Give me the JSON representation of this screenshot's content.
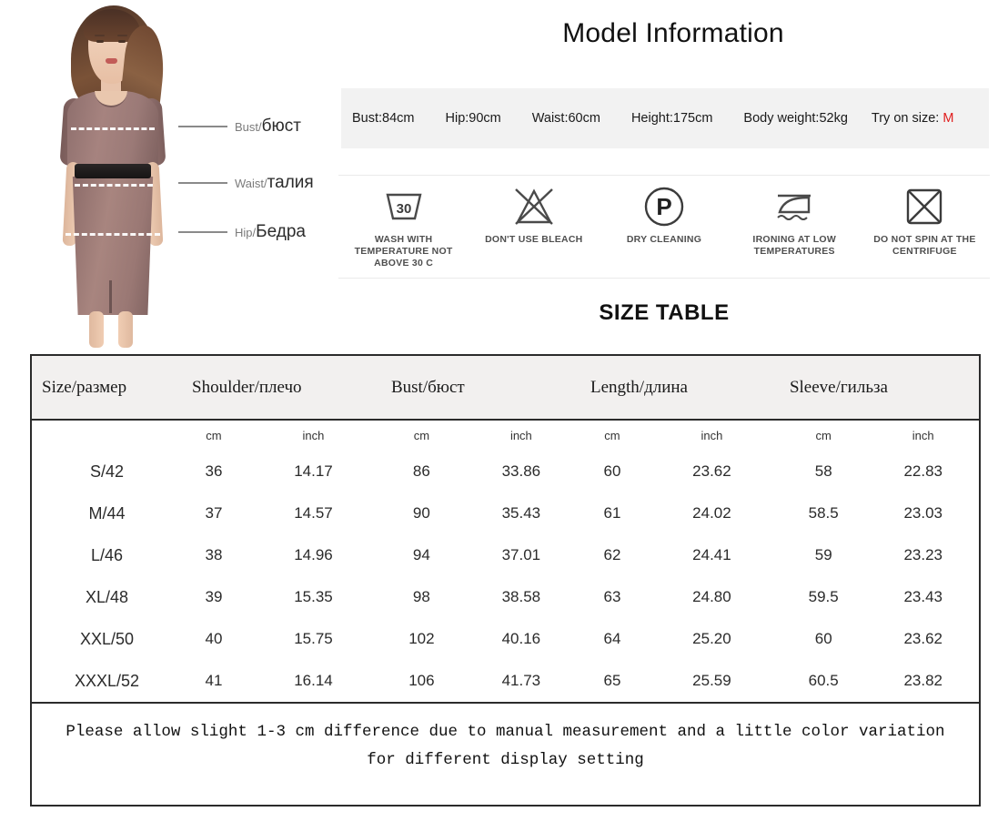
{
  "model_panel": {
    "callouts": [
      {
        "en": "Bust/",
        "ru": "бюст"
      },
      {
        "en": "Waist/",
        "ru": "талия"
      },
      {
        "en": "Hip/",
        "ru": "Бедра"
      }
    ]
  },
  "model_info": {
    "title": "Model Information",
    "measurements": [
      "Bust:84cm",
      "Hip:90cm",
      "Waist:60cm",
      "Height:175cm",
      "Body weight:52kg"
    ],
    "try_on_label": "Try on size:",
    "try_on_size": "M",
    "try_on_color": "#e01b1b"
  },
  "care": {
    "items": [
      {
        "icon": "wash-tub-30-icon",
        "label": "WASH WITH TEMPERATURE NOT ABOVE 30 C",
        "temp": "30"
      },
      {
        "icon": "no-bleach-triangle-icon",
        "label": "DON'T USE BLEACH"
      },
      {
        "icon": "dry-clean-p-circle-icon",
        "label": "DRY CLEANING",
        "letter": "P"
      },
      {
        "icon": "iron-low-temp-icon",
        "label": "IRONING AT LOW TEMPERATURES"
      },
      {
        "icon": "no-spin-centrifuge-icon",
        "label": "DO NOT SPIN AT THE CENTRIFUGE"
      }
    ]
  },
  "size_table": {
    "title": "SIZE TABLE",
    "headers": [
      "Size/размер",
      "Shoulder/плечо",
      "Bust/бюст",
      "Length/длина",
      "Sleeve/гильза"
    ],
    "units": [
      "",
      "cm",
      "inch",
      "cm",
      "inch",
      "cm",
      "inch",
      "cm",
      "inch"
    ],
    "rows": [
      {
        "size": "S/42",
        "shoulder_cm": "36",
        "shoulder_in": "14.17",
        "bust_cm": "86",
        "bust_in": "33.86",
        "length_cm": "60",
        "length_in": "23.62",
        "sleeve_cm": "58",
        "sleeve_in": "22.83"
      },
      {
        "size": "M/44",
        "shoulder_cm": "37",
        "shoulder_in": "14.57",
        "bust_cm": "90",
        "bust_in": "35.43",
        "length_cm": "61",
        "length_in": "24.02",
        "sleeve_cm": "58.5",
        "sleeve_in": "23.03"
      },
      {
        "size": "L/46",
        "shoulder_cm": "38",
        "shoulder_in": "14.96",
        "bust_cm": "94",
        "bust_in": "37.01",
        "length_cm": "62",
        "length_in": "24.41",
        "sleeve_cm": "59",
        "sleeve_in": "23.23"
      },
      {
        "size": "XL/48",
        "shoulder_cm": "39",
        "shoulder_in": "15.35",
        "bust_cm": "98",
        "bust_in": "38.58",
        "length_cm": "63",
        "length_in": "24.80",
        "sleeve_cm": "59.5",
        "sleeve_in": "23.43"
      },
      {
        "size": "XXL/50",
        "shoulder_cm": "40",
        "shoulder_in": "15.75",
        "bust_cm": "102",
        "bust_in": "40.16",
        "length_cm": "64",
        "length_in": "25.20",
        "sleeve_cm": "60",
        "sleeve_in": "23.62"
      },
      {
        "size": "XXXL/52",
        "shoulder_cm": "41",
        "shoulder_in": "16.14",
        "bust_cm": "106",
        "bust_in": "41.73",
        "length_cm": "65",
        "length_in": "25.59",
        "sleeve_cm": "60.5",
        "sleeve_in": "23.82"
      }
    ],
    "note": "Please allow slight 1-3 cm difference due to manual measurement and a little color variation for different display setting"
  }
}
